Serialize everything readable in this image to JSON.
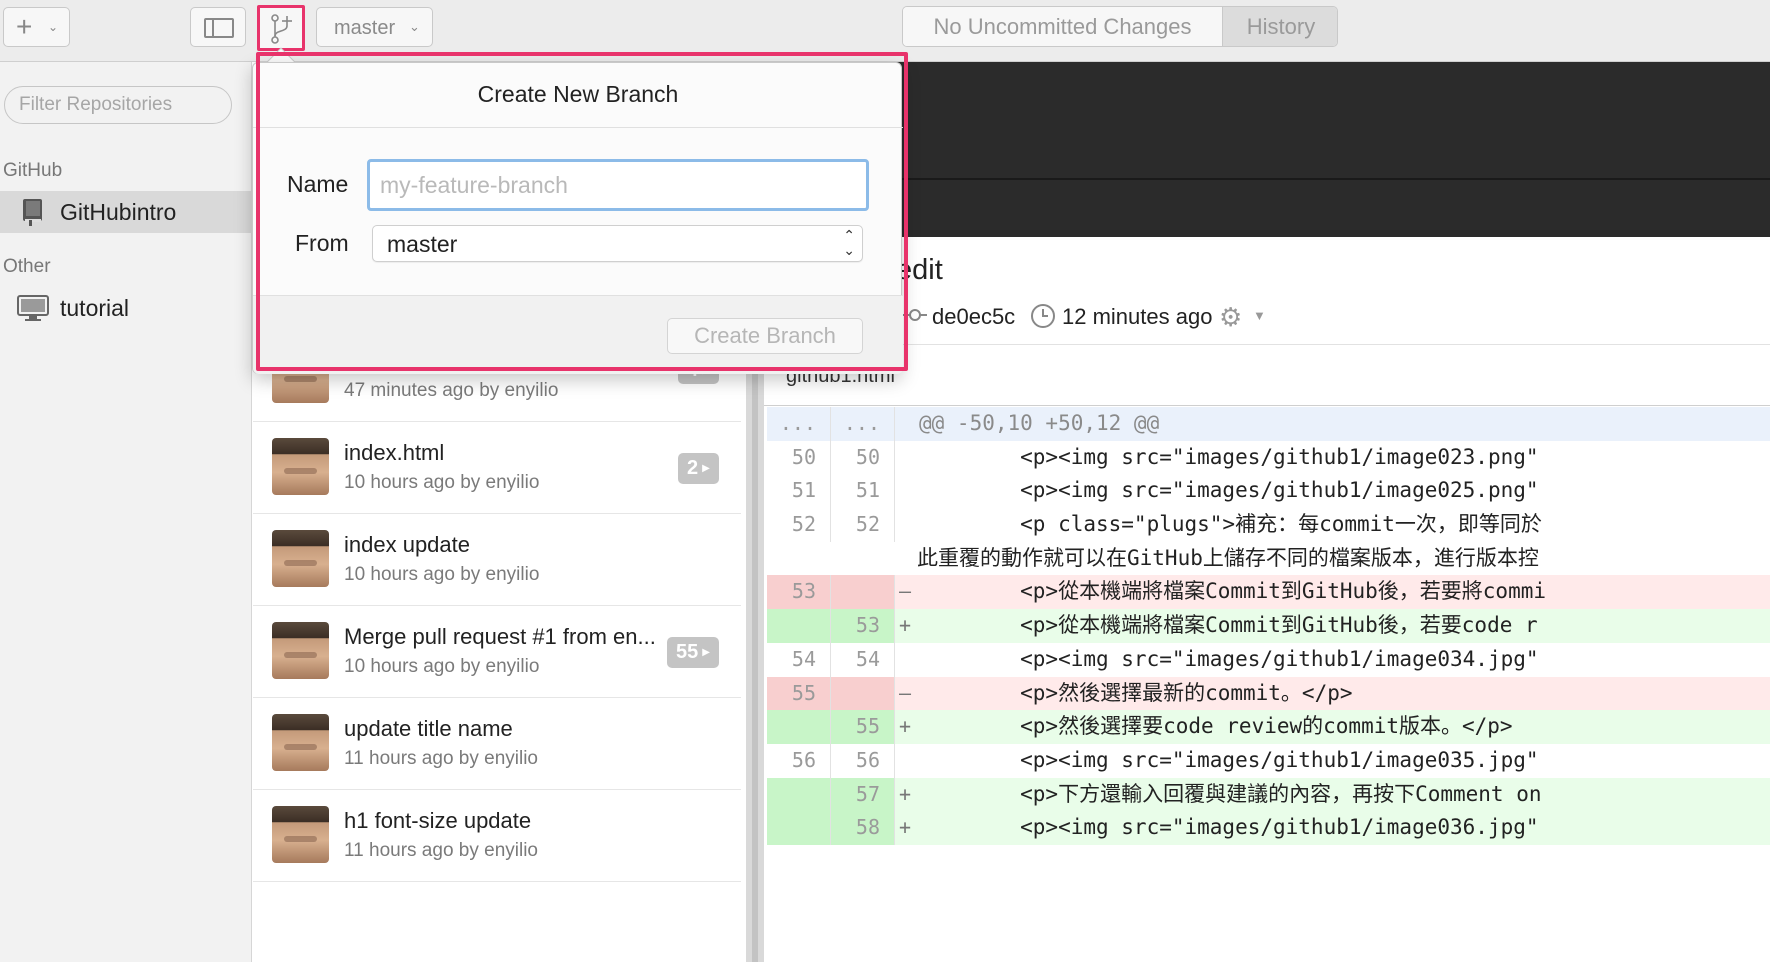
{
  "toolbar": {
    "branch_selector": "master",
    "seg_uncommitted": "No Uncommitted Changes",
    "seg_history": "History"
  },
  "sidebar": {
    "filter_placeholder": "Filter Repositories",
    "sections": [
      {
        "title": "GitHub",
        "repos": [
          {
            "name": "GitHubintro",
            "icon": "repo-book-icon"
          }
        ]
      },
      {
        "title": "Other",
        "repos": [
          {
            "name": "tutorial",
            "icon": "computer-icon"
          }
        ]
      }
    ]
  },
  "commits": [
    {
      "title": "",
      "meta": "47 minutes ago by enyilio",
      "badge": "4"
    },
    {
      "title": "index.html",
      "meta": "10 hours ago by enyilio",
      "badge": "2"
    },
    {
      "title": "index update",
      "meta": "10 hours ago by enyilio",
      "badge": ""
    },
    {
      "title": "Merge pull request #1 from en...",
      "meta": "10 hours ago by enyilio",
      "badge": "55"
    },
    {
      "title": "update title name",
      "meta": "11 hours ago by enyilio",
      "badge": ""
    },
    {
      "title": "h1 font-size update",
      "meta": "11 hours ago by enyilio",
      "badge": ""
    }
  ],
  "detail": {
    "title_partial": "edit",
    "sha": "de0ec5c",
    "time": "12 minutes ago",
    "filename_partial": "github1.html",
    "diff": [
      {
        "type": "hunk",
        "old": "...",
        "new": "...",
        "sign": "",
        "code": "@@ -50,10 +50,12 @@"
      },
      {
        "type": "ctx",
        "old": "50",
        "new": "50",
        "sign": "",
        "code": "        <p><img src=\"images/github1/image023.png\""
      },
      {
        "type": "ctx",
        "old": "51",
        "new": "51",
        "sign": "",
        "code": "        <p><img src=\"images/github1/image025.png\""
      },
      {
        "type": "ctx",
        "old": "52",
        "new": "52",
        "sign": "",
        "code": "        <p class=\"plugs\">補充：每commit一次，即等同於"
      },
      {
        "type": "wrap",
        "old": "",
        "new": "",
        "sign": "",
        "code": "此重覆的動作就可以在GitHub上儲存不同的檔案版本，進行版本控"
      },
      {
        "type": "del",
        "old": "53",
        "new": "",
        "sign": "–",
        "code": "        <p>從本機端將檔案Commit到GitHub後，若要將commi"
      },
      {
        "type": "add",
        "old": "",
        "new": "53",
        "sign": "+",
        "code": "        <p>從本機端將檔案Commit到GitHub後，若要code r"
      },
      {
        "type": "ctx",
        "old": "54",
        "new": "54",
        "sign": "",
        "code": "        <p><img src=\"images/github1/image034.jpg\""
      },
      {
        "type": "del",
        "old": "55",
        "new": "",
        "sign": "–",
        "code": "        <p>然後選擇最新的commit。</p>"
      },
      {
        "type": "add",
        "old": "",
        "new": "55",
        "sign": "+",
        "code": "        <p>然後選擇要code review的commit版本。</p>"
      },
      {
        "type": "ctx",
        "old": "56",
        "new": "56",
        "sign": "",
        "code": "        <p><img src=\"images/github1/image035.jpg\""
      },
      {
        "type": "add",
        "old": "",
        "new": "57",
        "sign": "+",
        "code": "        <p>下方還輸入回覆與建議的內容，再按下Comment on"
      },
      {
        "type": "add",
        "old": "",
        "new": "58",
        "sign": "+",
        "code": "        <p><img src=\"images/github1/image036.jpg\""
      }
    ]
  },
  "popover": {
    "title": "Create New Branch",
    "name_label": "Name",
    "name_placeholder": "my-feature-branch",
    "from_label": "From",
    "from_value": "master",
    "create_button": "Create Branch"
  },
  "colors": {
    "highlight": "#e8336b",
    "input_focus": "#8cbbe8"
  }
}
